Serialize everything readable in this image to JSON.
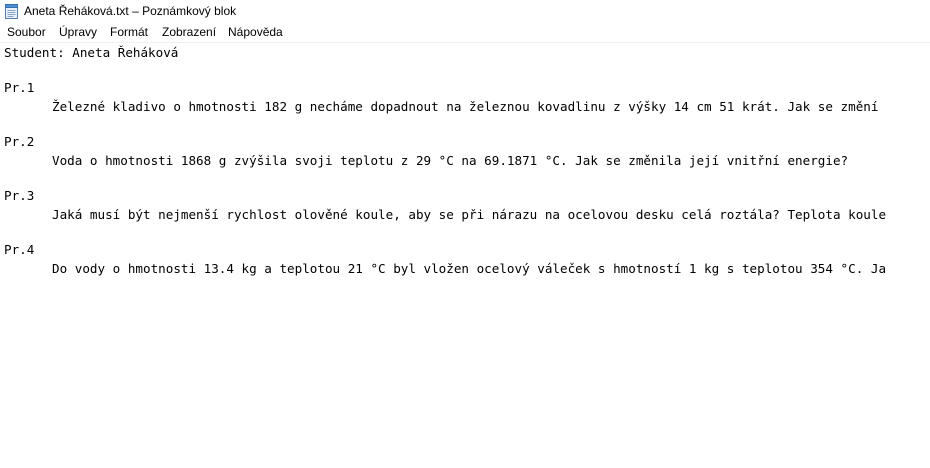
{
  "window": {
    "title": "Aneta Řeháková.txt – Poznámkový blok"
  },
  "menu": {
    "items": [
      "Soubor",
      "Úpravy",
      "Formát",
      "Zobrazení",
      "Nápověda"
    ]
  },
  "editor": {
    "student_line": "Student: Aneta Řeháková",
    "problems": [
      {
        "label": "Pr.1",
        "text": "Železné kladivo o hmotnosti 182 g necháme dopadnout na železnou kovadlinu z výšky 14 cm 51 krát. Jak se změní"
      },
      {
        "label": "Pr.2",
        "text": "Voda o hmotnosti 1868 g zvýšila svoji teplotu z 29 °C na 69.1871 °C. Jak se změnila její vnitřní energie?"
      },
      {
        "label": "Pr.3",
        "text": "Jaká musí být nejmenší rychlost olověné koule, aby se při nárazu na ocelovou desku celá roztála? Teplota koule"
      },
      {
        "label": "Pr.4",
        "text": "Do vody o hmotnosti 13.4 kg a teplotou 21 °C byl vložen ocelový váleček s hmotností 1 kg s teplotou 354 °C. Ja"
      }
    ]
  },
  "icons": {
    "app_icon": "notepad-icon"
  }
}
